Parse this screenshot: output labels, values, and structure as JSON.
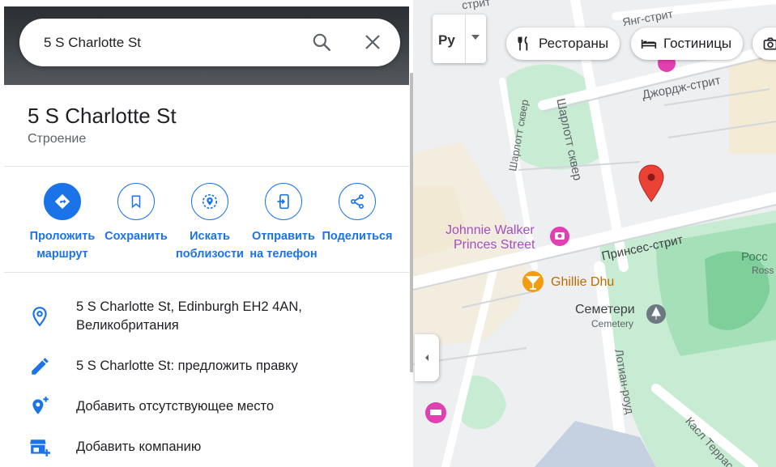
{
  "search": {
    "value": "5 S Charlotte St"
  },
  "place": {
    "title": "5 S Charlotte St",
    "type": "Строение"
  },
  "actions": [
    {
      "line1": "Проложить",
      "line2": "маршрут"
    },
    {
      "line1": "Сохранить",
      "line2": ""
    },
    {
      "line1": "Искать",
      "line2": "поблизости"
    },
    {
      "line1": "Отправить",
      "line2": "на телефон"
    },
    {
      "line1": "Поделиться",
      "line2": ""
    }
  ],
  "info": {
    "address_line1": "5 S Charlotte St, Edinburgh EH2 4AN,",
    "address_line2": "Великобритания",
    "suggest_edit": "5 S Charlotte St: предложить правку",
    "add_missing_place": "Добавить отсутствующее место",
    "add_business": "Добавить компанию"
  },
  "map": {
    "language_button": "Ру",
    "chips": [
      "Рестораны",
      "Гостиницы"
    ],
    "streets": {
      "young": "Янг-стрит",
      "george": "Джордж-стрит",
      "charlotte_square_east": "Шарлотт сквер",
      "charlotte_square_west": "Шарлотт сквер",
      "princes": "Принсес-стрит",
      "lothian": "Лотиан-роуд",
      "castle_terrace": "Касл Терраса",
      "top_fragment": "стрит"
    },
    "pois": {
      "johnnie_walker_line1": "Johnnie Walker",
      "johnnie_walker_line2": "Princes Street",
      "ghillie_dhu": "Ghillie Dhu",
      "cemetery_ru": "Семетери",
      "cemetery_en": "Cemetery",
      "ross_ru": "Росс",
      "ross_en": "Ross"
    },
    "colors": {
      "park": "#c8ecd3",
      "park_dark": "#86d4a4",
      "pin": "#ea4335",
      "poi_pink": "#e040b0",
      "poi_orange": "#f39c12",
      "accent": "#1a73e8"
    }
  }
}
